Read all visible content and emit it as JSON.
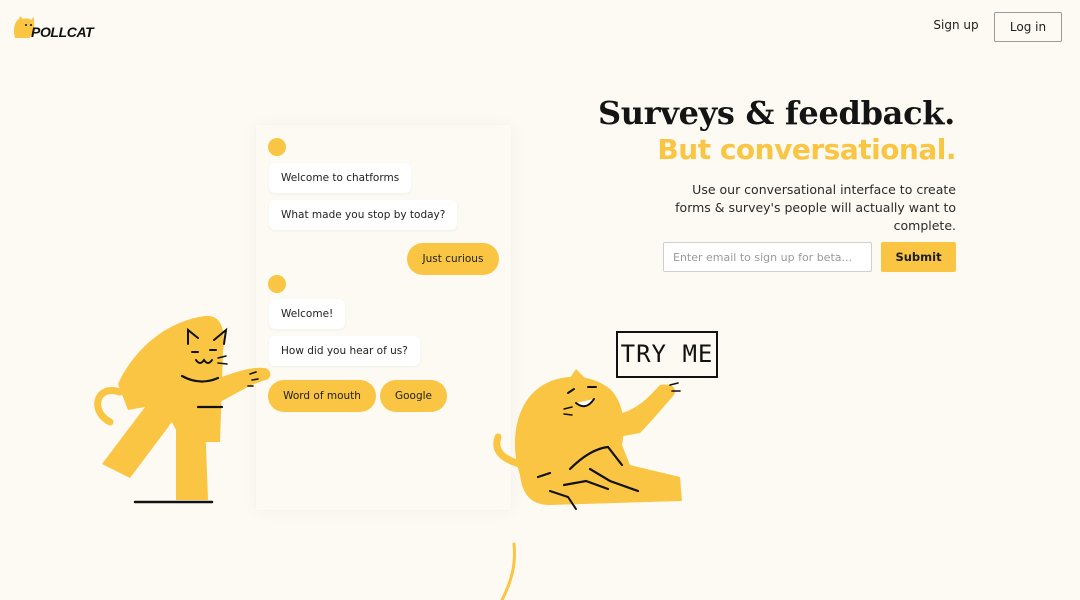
{
  "brand": {
    "name": "POLLCAT"
  },
  "nav": {
    "signup_label": "Sign up",
    "login_label": "Log in"
  },
  "chat": {
    "messages_1": [
      "Welcome to chatforms",
      "What made you stop by today?"
    ],
    "reply_1": "Just curious",
    "messages_2": [
      "Welcome!",
      "How did you hear of us?"
    ],
    "options": [
      "Word of mouth",
      "Google"
    ]
  },
  "hero": {
    "headline": "Surveys & feedback.",
    "subheadline": "But conversational.",
    "description": "Use our conversational interface to create forms & survey's people will actually want to complete.",
    "email_placeholder": "Enter email to sign up for beta...",
    "submit_label": "Submit"
  },
  "sign": {
    "text": "TRY ME"
  },
  "colors": {
    "accent": "#f9c543",
    "background": "#fdfaf4",
    "ink": "#141414"
  },
  "icons": [
    "cat-logo-icon",
    "cat-pointing-illustration",
    "cat-sitting-illustration",
    "try-me-sign"
  ]
}
